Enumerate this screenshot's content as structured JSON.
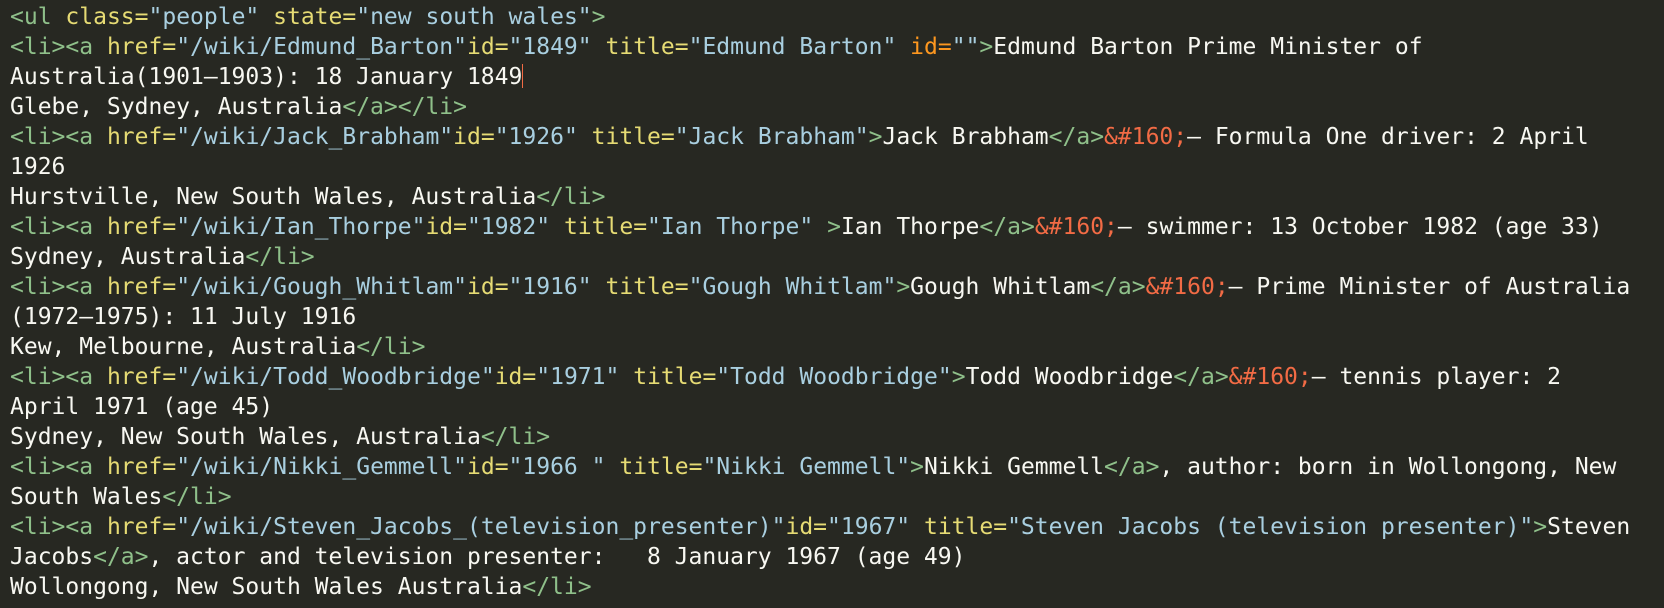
{
  "colors": {
    "background": "#272822",
    "text": "#f8f8f2",
    "tag": "#8fc08a",
    "attribute": "#e6db74",
    "attribute_alt": "#fd971f",
    "string": "#a9cfe0",
    "entity": "#f26b45",
    "cursor": "#f26b45"
  },
  "lines": [
    [
      {
        "t": "tag",
        "v": "<ul"
      },
      {
        "t": "txt",
        "v": " "
      },
      {
        "t": "attr",
        "v": "class="
      },
      {
        "t": "str",
        "v": "\"people\""
      },
      {
        "t": "txt",
        "v": " "
      },
      {
        "t": "attr",
        "v": "state="
      },
      {
        "t": "str",
        "v": "\"new south wales\""
      },
      {
        "t": "tag",
        "v": ">"
      }
    ],
    [
      {
        "t": "tag",
        "v": "<li><a"
      },
      {
        "t": "txt",
        "v": " "
      },
      {
        "t": "attr",
        "v": "href="
      },
      {
        "t": "str",
        "v": "\"/wiki/Edmund_Barton\""
      },
      {
        "t": "attr",
        "v": "id="
      },
      {
        "t": "str",
        "v": "\"1849\""
      },
      {
        "t": "txt",
        "v": " "
      },
      {
        "t": "attr",
        "v": "title="
      },
      {
        "t": "str",
        "v": "\"Edmund Barton\""
      },
      {
        "t": "txt",
        "v": " "
      },
      {
        "t": "attr-orange",
        "v": "id="
      },
      {
        "t": "str",
        "v": "\"\""
      },
      {
        "t": "tag",
        "v": ">"
      },
      {
        "t": "txt",
        "v": "Edmund Barton Prime Minister of"
      }
    ],
    [
      {
        "t": "txt",
        "v": "Australia(1901–1903): 18 January 1849"
      },
      {
        "t": "cursor",
        "v": ""
      }
    ],
    [
      {
        "t": "txt",
        "v": "Glebe, Sydney, Australia"
      },
      {
        "t": "tag",
        "v": "</a></li>"
      }
    ],
    [
      {
        "t": "tag",
        "v": "<li><a"
      },
      {
        "t": "txt",
        "v": " "
      },
      {
        "t": "attr",
        "v": "href="
      },
      {
        "t": "str",
        "v": "\"/wiki/Jack_Brabham\""
      },
      {
        "t": "attr",
        "v": "id="
      },
      {
        "t": "str",
        "v": "\"1926\""
      },
      {
        "t": "txt",
        "v": " "
      },
      {
        "t": "attr",
        "v": "title="
      },
      {
        "t": "str",
        "v": "\"Jack Brabham\""
      },
      {
        "t": "tag",
        "v": ">"
      },
      {
        "t": "txt",
        "v": "Jack Brabham"
      },
      {
        "t": "tag",
        "v": "</a>"
      },
      {
        "t": "ent",
        "v": "&#160;"
      },
      {
        "t": "txt",
        "v": "– Formula One driver: 2 April"
      }
    ],
    [
      {
        "t": "txt",
        "v": "1926"
      }
    ],
    [
      {
        "t": "txt",
        "v": "Hurstville, New South Wales, Australia"
      },
      {
        "t": "tag",
        "v": "</li>"
      }
    ],
    [
      {
        "t": "tag",
        "v": "<li><a"
      },
      {
        "t": "txt",
        "v": " "
      },
      {
        "t": "attr",
        "v": "href="
      },
      {
        "t": "str",
        "v": "\"/wiki/Ian_Thorpe\""
      },
      {
        "t": "attr",
        "v": "id="
      },
      {
        "t": "str",
        "v": "\"1982\""
      },
      {
        "t": "txt",
        "v": " "
      },
      {
        "t": "attr",
        "v": "title="
      },
      {
        "t": "str",
        "v": "\"Ian Thorpe\""
      },
      {
        "t": "txt",
        "v": " "
      },
      {
        "t": "tag",
        "v": ">"
      },
      {
        "t": "txt",
        "v": "Ian Thorpe"
      },
      {
        "t": "tag",
        "v": "</a>"
      },
      {
        "t": "ent",
        "v": "&#160;"
      },
      {
        "t": "txt",
        "v": "– swimmer: 13 October 1982 (age 33)"
      }
    ],
    [
      {
        "t": "txt",
        "v": "Sydney, Australia"
      },
      {
        "t": "tag",
        "v": "</li>"
      }
    ],
    [
      {
        "t": "tag",
        "v": "<li><a"
      },
      {
        "t": "txt",
        "v": " "
      },
      {
        "t": "attr",
        "v": "href="
      },
      {
        "t": "str",
        "v": "\"/wiki/Gough_Whitlam\""
      },
      {
        "t": "attr",
        "v": "id="
      },
      {
        "t": "str",
        "v": "\"1916\""
      },
      {
        "t": "txt",
        "v": " "
      },
      {
        "t": "attr",
        "v": "title="
      },
      {
        "t": "str",
        "v": "\"Gough Whitlam\""
      },
      {
        "t": "tag",
        "v": ">"
      },
      {
        "t": "txt",
        "v": "Gough Whitlam"
      },
      {
        "t": "tag",
        "v": "</a>"
      },
      {
        "t": "ent",
        "v": "&#160;"
      },
      {
        "t": "txt",
        "v": "– Prime Minister of Australia"
      }
    ],
    [
      {
        "t": "txt",
        "v": "(1972–1975): 11 July 1916"
      }
    ],
    [
      {
        "t": "txt",
        "v": "Kew, Melbourne, Australia"
      },
      {
        "t": "tag",
        "v": "</li>"
      }
    ],
    [
      {
        "t": "tag",
        "v": "<li><a"
      },
      {
        "t": "txt",
        "v": " "
      },
      {
        "t": "attr",
        "v": "href="
      },
      {
        "t": "str",
        "v": "\"/wiki/Todd_Woodbridge\""
      },
      {
        "t": "attr",
        "v": "id="
      },
      {
        "t": "str",
        "v": "\"1971\""
      },
      {
        "t": "txt",
        "v": " "
      },
      {
        "t": "attr",
        "v": "title="
      },
      {
        "t": "str",
        "v": "\"Todd Woodbridge\""
      },
      {
        "t": "tag",
        "v": ">"
      },
      {
        "t": "txt",
        "v": "Todd Woodbridge"
      },
      {
        "t": "tag",
        "v": "</a>"
      },
      {
        "t": "ent",
        "v": "&#160;"
      },
      {
        "t": "txt",
        "v": "– tennis player: 2"
      }
    ],
    [
      {
        "t": "txt",
        "v": "April 1971 (age 45)"
      }
    ],
    [
      {
        "t": "txt",
        "v": "Sydney, New South Wales, Australia"
      },
      {
        "t": "tag",
        "v": "</li>"
      }
    ],
    [
      {
        "t": "tag",
        "v": "<li><a"
      },
      {
        "t": "txt",
        "v": " "
      },
      {
        "t": "attr",
        "v": "href="
      },
      {
        "t": "str",
        "v": "\"/wiki/Nikki_Gemmell\""
      },
      {
        "t": "attr",
        "v": "id="
      },
      {
        "t": "str",
        "v": "\"1966 \""
      },
      {
        "t": "txt",
        "v": " "
      },
      {
        "t": "attr",
        "v": "title="
      },
      {
        "t": "str",
        "v": "\"Nikki Gemmell\""
      },
      {
        "t": "tag",
        "v": ">"
      },
      {
        "t": "txt",
        "v": "Nikki Gemmell"
      },
      {
        "t": "tag",
        "v": "</a>"
      },
      {
        "t": "txt",
        "v": ", author: born in Wollongong, New"
      }
    ],
    [
      {
        "t": "txt",
        "v": "South Wales"
      },
      {
        "t": "tag",
        "v": "</li>"
      }
    ],
    [
      {
        "t": "tag",
        "v": "<li><a"
      },
      {
        "t": "txt",
        "v": " "
      },
      {
        "t": "attr",
        "v": "href="
      },
      {
        "t": "str",
        "v": "\"/wiki/Steven_Jacobs_(television_presenter)\""
      },
      {
        "t": "attr",
        "v": "id="
      },
      {
        "t": "str",
        "v": "\"1967\""
      },
      {
        "t": "txt",
        "v": " "
      },
      {
        "t": "attr",
        "v": "title="
      },
      {
        "t": "str",
        "v": "\"Steven Jacobs (television presenter)\""
      },
      {
        "t": "tag",
        "v": ">"
      },
      {
        "t": "txt",
        "v": "Steven"
      }
    ],
    [
      {
        "t": "txt",
        "v": "Jacobs"
      },
      {
        "t": "tag",
        "v": "</a>"
      },
      {
        "t": "txt",
        "v": ", actor and television presenter:   8 January 1967 (age 49)"
      }
    ],
    [
      {
        "t": "txt",
        "v": "Wollongong, New South Wales Australia"
      },
      {
        "t": "tag",
        "v": "</li>"
      }
    ]
  ]
}
